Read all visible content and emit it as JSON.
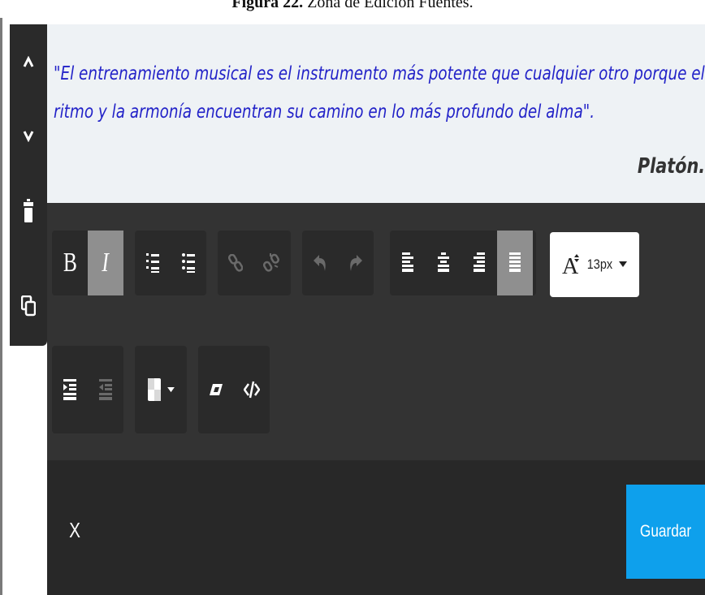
{
  "caption": {
    "label": "Figura 22.",
    "text": "Zona de Edición Fuentes."
  },
  "side_toolbar": {
    "items": [
      {
        "icon": "chevron-up-icon"
      },
      {
        "icon": "chevron-down-icon"
      },
      {
        "icon": "trash-icon"
      },
      {
        "icon": "copy-icon"
      }
    ]
  },
  "content": {
    "quote": "\"El entrenamiento musical es el instrumento más potente que cualquier otro porque el ritmo y la armonía encuentran su camino en lo más profundo del alma\".",
    "author": "Platón."
  },
  "toolbar": {
    "bold_label": "B",
    "italic_label": "I",
    "italic_active": true,
    "justify_active": true,
    "font_size": "13px",
    "colors": {
      "active": "#8f8f8f",
      "group_bg": "#2a2a2a",
      "disabled": "#6a6a6a"
    }
  },
  "footer": {
    "close_label": "X",
    "save_label": "Guardar",
    "save_color": "#0ea0ec"
  }
}
